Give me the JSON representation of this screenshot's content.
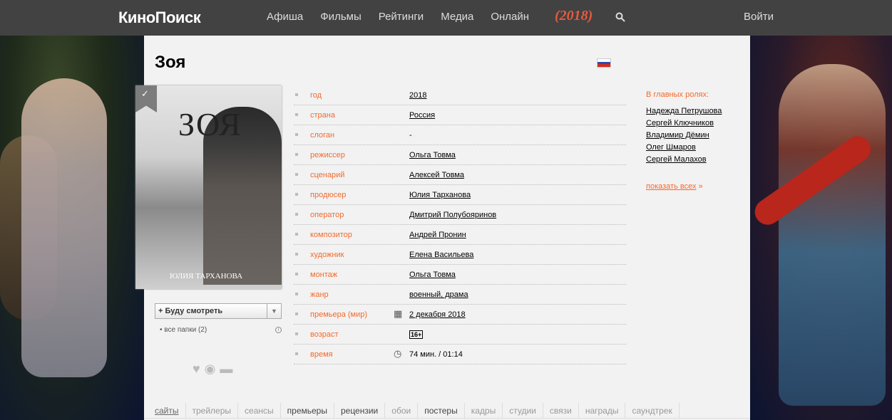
{
  "header": {
    "logo": "КиноПоиск",
    "nav": [
      "Афиша",
      "Фильмы",
      "Рейтинги",
      "Медиа",
      "Онлайн"
    ],
    "year_badge": "(2018)",
    "login": "Войти"
  },
  "film": {
    "title": "Зоя",
    "poster_title": "ЗОЯ",
    "poster_caption": "ЮЛИЯ ТАРХАНОВА",
    "bookmark_icon": "check-icon",
    "watch_button": "+ Буду смотреть",
    "folders": "• все папки (2)",
    "details": [
      {
        "label": "год",
        "value": "2018"
      },
      {
        "label": "страна",
        "value": "Россия"
      },
      {
        "label": "слоган",
        "value": "-"
      },
      {
        "label": "режиссер",
        "value": "Ольга Товма"
      },
      {
        "label": "сценарий",
        "value": "Алексей Товма"
      },
      {
        "label": "продюсер",
        "value": "Юлия Тарханова"
      },
      {
        "label": "оператор",
        "value": "Дмитрий Полубояринов"
      },
      {
        "label": "композитор",
        "value": "Андрей Пронин"
      },
      {
        "label": "художник",
        "value": "Елена Васильева"
      },
      {
        "label": "монтаж",
        "value": "Ольга Товма"
      },
      {
        "label": "жанр",
        "value": "военный, драма"
      },
      {
        "label": "премьера (мир)",
        "value": "2 декабря 2018"
      },
      {
        "label": "возраст",
        "value": "16+"
      },
      {
        "label": "время",
        "value": "74 мин. / 01:14"
      }
    ]
  },
  "cast": {
    "heading": "В главных ролях:",
    "actors": [
      "Надежда Петрушова",
      "Сергей Ключников",
      "Владимир Дёмин",
      "Олег Шмаров",
      "Сергей Малахов"
    ],
    "show_all": "показать всех",
    "show_all_arrow": "»"
  },
  "tabs": [
    "сайты",
    "трейлеры",
    "сеансы",
    "премьеры",
    "рецензии",
    "обои",
    "постеры",
    "кадры",
    "студии",
    "связи",
    "награды",
    "саундтрек"
  ],
  "colors": {
    "accent": "#f26a2c",
    "topbar": "#424242",
    "content_bg": "#f2f2f2"
  }
}
